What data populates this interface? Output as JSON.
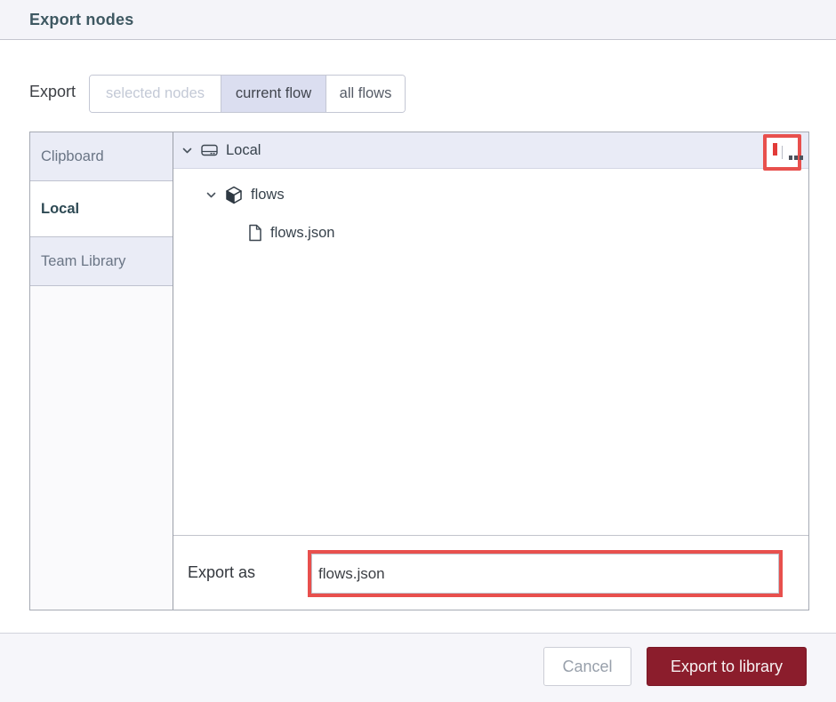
{
  "title": "Export nodes",
  "scope": {
    "label": "Export",
    "options": [
      {
        "label": "selected nodes",
        "state": "disabled"
      },
      {
        "label": "current flow",
        "state": "selected"
      },
      {
        "label": "all flows",
        "state": "normal"
      }
    ]
  },
  "sidebar": {
    "tabs": [
      {
        "label": "Clipboard",
        "active": false
      },
      {
        "label": "Local",
        "active": true
      },
      {
        "label": "Team Library",
        "active": false
      }
    ]
  },
  "tree": {
    "rows": [
      {
        "label": "Local",
        "icon": "hard-drive-icon",
        "expanded": true
      },
      {
        "label": "flows",
        "icon": "cube-icon",
        "expanded": true
      },
      {
        "label": "flows.json",
        "icon": "file-icon"
      }
    ],
    "menu_icon": "ellipsis-menu-icon"
  },
  "export_as": {
    "label": "Export as",
    "value": "flows.json"
  },
  "footer": {
    "cancel": "Cancel",
    "confirm": "Export to library"
  },
  "icons": {
    "chevron": "chevron-down-icon",
    "drive": "hard-drive-icon",
    "package": "cube-icon",
    "file": "file-icon",
    "menu": "ellipsis-menu-icon"
  },
  "colors": {
    "confirm_bg": "#8b1d2c",
    "annotation_red": "#e8504d",
    "lavender": "#e9ebf6",
    "selected_segment": "#dbdef0",
    "header_bg": "#f4f4f9",
    "title_text": "#3e5862"
  }
}
